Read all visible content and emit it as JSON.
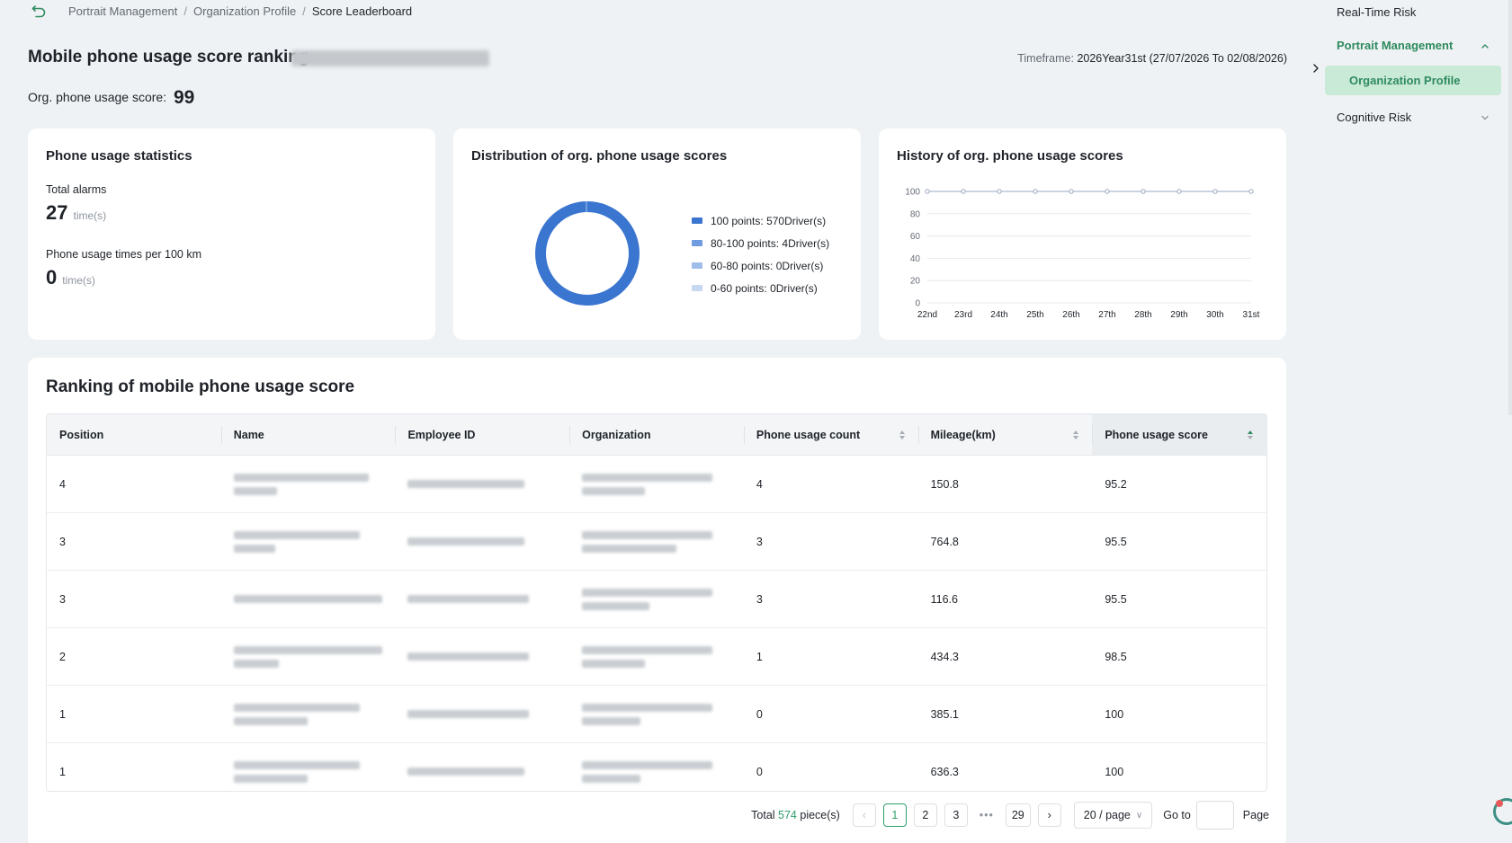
{
  "breadcrumb": {
    "items": [
      "Portrait Management",
      "Organization Profile"
    ],
    "separator": "/",
    "current": "Score Leaderboard"
  },
  "header": {
    "title": "Mobile phone usage score ranking-",
    "timeframe_label": "Timeframe:",
    "timeframe_value": "2026Year31st (27/07/2026 To 02/08/2026)",
    "org_score_label": "Org. phone usage score:",
    "org_score_value": "99"
  },
  "stats": {
    "title": "Phone usage statistics",
    "total_alarms_label": "Total alarms",
    "total_alarms_value": "27",
    "per100_label": "Phone usage times per 100 km",
    "per100_value": "0",
    "unit": "time(s)"
  },
  "distribution": {
    "title": "Distribution of org. phone usage scores",
    "legend": [
      {
        "label": "100 points:",
        "value": "570Driver(s)"
      },
      {
        "label": "80-100 points:",
        "value": "4Driver(s)"
      },
      {
        "label": "60-80 points:",
        "value": "0Driver(s)"
      },
      {
        "label": "0-60 points:",
        "value": "0Driver(s)"
      }
    ]
  },
  "history": {
    "title": "History of org. phone usage scores"
  },
  "chart_data": [
    {
      "type": "pie",
      "variant": "donut",
      "categories": [
        "100 points",
        "80-100 points",
        "60-80 points",
        "0-60 points"
      ],
      "values": [
        570,
        4,
        0,
        0
      ],
      "colors": [
        "#3a75cf",
        "#6f9ce0",
        "#9ebde9",
        "#c7d8f1"
      ]
    },
    {
      "type": "line",
      "x": [
        "22nd",
        "23rd",
        "24th",
        "25th",
        "26th",
        "27th",
        "28th",
        "29th",
        "30th",
        "31st"
      ],
      "series": [
        {
          "values": [
            100,
            100,
            100,
            100,
            100,
            100,
            100,
            100,
            100,
            100
          ]
        }
      ],
      "ylim": [
        0,
        100
      ],
      "yticks": [
        0,
        20,
        40,
        60,
        80,
        100
      ],
      "grid": true
    }
  ],
  "ranking": {
    "title": "Ranking of mobile phone usage score",
    "columns": [
      "Position",
      "Name",
      "Employee ID",
      "Organization",
      "Phone usage count",
      "Mileage(km)",
      "Phone usage score"
    ],
    "rows": [
      {
        "position": "4",
        "count": "4",
        "mileage": "150.8",
        "score": "95.2"
      },
      {
        "position": "3",
        "count": "3",
        "mileage": "764.8",
        "score": "95.5"
      },
      {
        "position": "3",
        "count": "3",
        "mileage": "116.6",
        "score": "95.5"
      },
      {
        "position": "2",
        "count": "1",
        "mileage": "434.3",
        "score": "98.5"
      },
      {
        "position": "1",
        "count": "0",
        "mileage": "385.1",
        "score": "100"
      },
      {
        "position": "1",
        "count": "0",
        "mileage": "636.3",
        "score": "100"
      }
    ]
  },
  "pagination": {
    "total_prefix": "Total",
    "total_count": "574",
    "total_suffix": "piece(s)",
    "pages": [
      "1",
      "2",
      "3"
    ],
    "dots": "•••",
    "last_page": "29",
    "active_page": "1",
    "page_size": "20 / page",
    "goto_label": "Go to",
    "page_label": "Page"
  },
  "side_menu": {
    "real_time_risk": "Real-Time Risk",
    "portrait_management": "Portrait Management",
    "organization_profile": "Organization Profile",
    "cognitive_risk": "Cognitive Risk"
  },
  "colors": {
    "accent": "#2e8a5e",
    "active_bg": "#c9ead7",
    "chart_blue": "#3a75cf"
  }
}
